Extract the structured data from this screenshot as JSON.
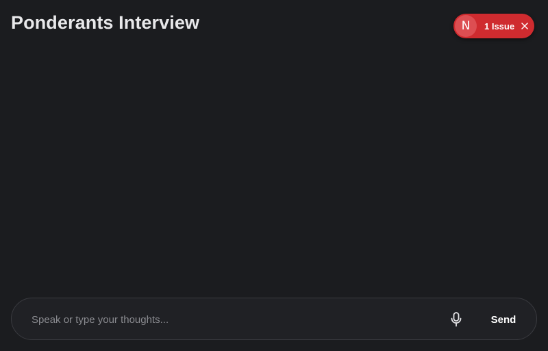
{
  "header": {
    "title": "Ponderants Interview"
  },
  "issue_badge": {
    "logo_letter": "N",
    "label": "1 Issue",
    "color": "#cf2b2f"
  },
  "composer": {
    "placeholder": "Speak or type your thoughts...",
    "value": "",
    "mic_icon": "microphone-icon",
    "send_label": "Send"
  },
  "theme": {
    "background": "#1b1c1f",
    "text": "#e8e8ea"
  }
}
